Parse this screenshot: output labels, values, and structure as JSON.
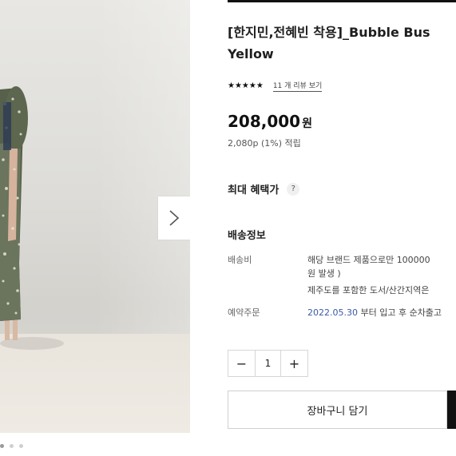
{
  "product": {
    "title_line1": "[한지민,전혜빈 착용]_Bubble Bus",
    "title_line2": "Yellow",
    "stars": "★★★★★",
    "review_link": "11 개 리뷰 보기",
    "price": "208,000",
    "currency": "원",
    "points": "2,080p (1%) 적립"
  },
  "benefit": {
    "label": "최대 혜택가",
    "help_glyph": "?"
  },
  "shipping": {
    "heading": "배송정보",
    "fee_label": "배송비",
    "fee_line1": "해당 브랜드 제품으로만 100000",
    "fee_line2": "원 발생 )",
    "fee_line3": "제주도를 포함한 도서/산간지역은",
    "preorder_label": "예약주문",
    "preorder_date": "2022.05.30",
    "preorder_rest": " 부터 입고 후 순차출고"
  },
  "quantity": {
    "minus": "−",
    "value": "1",
    "plus": "+"
  },
  "actions": {
    "cart_label": "장바구니 담기"
  },
  "icons": {
    "next": "chevron-right-icon",
    "help": "question-icon"
  },
  "colors": {
    "accent_date": "#3a5aa6",
    "buy_button": "#111111"
  }
}
